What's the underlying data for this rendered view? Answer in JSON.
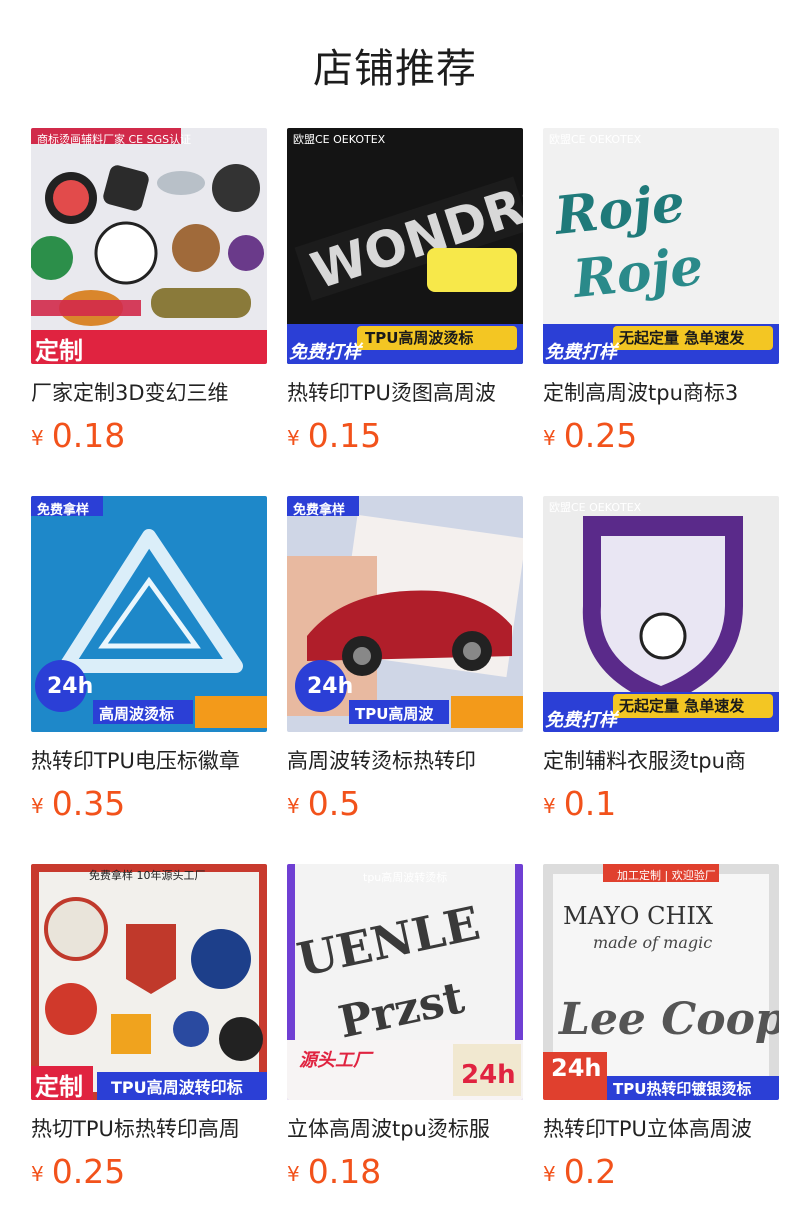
{
  "page": {
    "title": "店铺推荐"
  },
  "products": [
    {
      "name": "厂家定制3D变幻三维",
      "currency": "¥",
      "price": "0.18",
      "tag": "商标烫画辅料厂家  CE SGS认证",
      "badge": "定制",
      "icon": "collage"
    },
    {
      "name": "热转印TPU烫图高周波",
      "currency": "¥",
      "price": "0.15",
      "tag": "欧盟CE OEKOTEX",
      "badge": "免费打样",
      "banner": "TPU高周波烫标",
      "icon": "letters"
    },
    {
      "name": "定制高周波tpu商标3",
      "currency": "¥",
      "price": "0.25",
      "tag": "欧盟CE OEKOTEX",
      "badge": "免费打样",
      "banner": "无起定量 急单速发",
      "icon": "rose"
    },
    {
      "name": "热转印TPU电压标徽章",
      "currency": "¥",
      "price": "0.35",
      "tag": "免费拿样",
      "badge": "24h",
      "banner": "高周波烫标",
      "icon": "triangle"
    },
    {
      "name": "高周波转烫标热转印",
      "currency": "¥",
      "price": "0.5",
      "tag": "免费拿样",
      "badge": "24h",
      "banner": "TPU高周波",
      "icon": "car"
    },
    {
      "name": "定制辅料衣服烫tpu商",
      "currency": "¥",
      "price": "0.1",
      "tag": "欧盟CE OEKOTEX",
      "badge": "免费打样",
      "banner": "无起定量 急单速发",
      "icon": "shield"
    },
    {
      "name": "热切TPU标热转印高周",
      "currency": "¥",
      "price": "0.25",
      "tag": "免费拿样  10年源头工厂",
      "badge": "定制",
      "banner": "TPU高周波转印标",
      "icon": "badges"
    },
    {
      "name": "立体高周波tpu烫标服",
      "currency": "¥",
      "price": "0.18",
      "tag": "tpu高周波转烫标",
      "badge": "源头工厂",
      "banner": "24h",
      "icon": "emboss"
    },
    {
      "name": "热转印TPU立体高周波",
      "currency": "¥",
      "price": "0.2",
      "tag": "加工定制 | 欢迎验厂",
      "badge": "24h",
      "banner": "TPU热转印镀银烫标",
      "icon": "mayo"
    }
  ]
}
